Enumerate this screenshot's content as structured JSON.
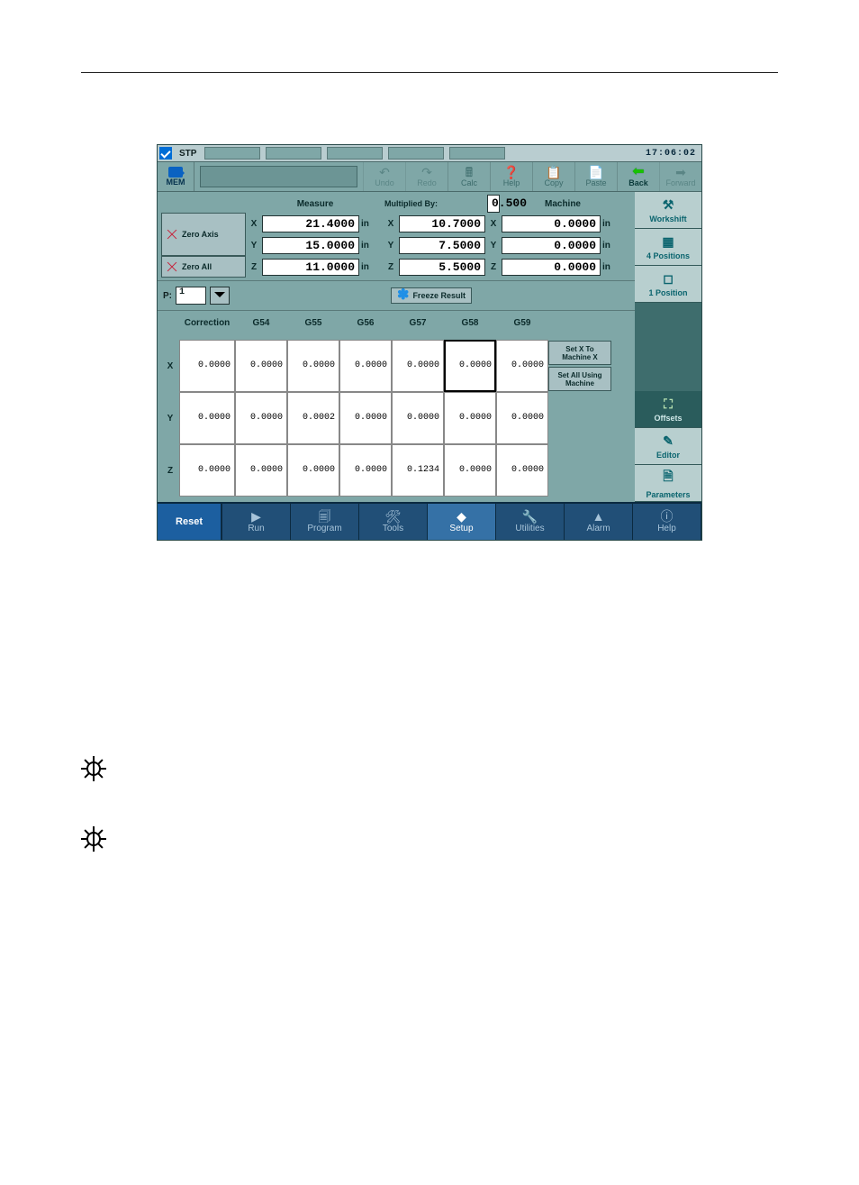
{
  "status": {
    "mode": "STP",
    "clock": "17:06:02"
  },
  "memLabel": "MEM",
  "toolbar": {
    "undo": "Undo",
    "redo": "Redo",
    "calc": "Calc",
    "help": "Help",
    "copy": "Copy",
    "paste": "Paste",
    "back": "Back",
    "forward": "Forward"
  },
  "rail": {
    "workshift": "Workshift",
    "fourPos": "4 Positions",
    "onePos": "1 Position",
    "offsets": "Offsets",
    "editor": "Editor",
    "parameters": "Parameters"
  },
  "readouts": {
    "measureHdr": "Measure",
    "multipliedHdr": "Multiplied By:",
    "machineHdr": "Machine",
    "zeroAxis": "Zero Axis",
    "zeroAll": "Zero All",
    "multiplier": "0.500",
    "rows": [
      {
        "ax": "X",
        "measure": "21.4000",
        "mUnit": "in",
        "mult": "10.7000",
        "mach": "0.0000",
        "machUnit": "in"
      },
      {
        "ax": "Y",
        "measure": "15.0000",
        "mUnit": "in",
        "mult": "7.5000",
        "mach": "0.0000",
        "machUnit": "in"
      },
      {
        "ax": "Z",
        "measure": "11.0000",
        "mUnit": "in",
        "mult": "5.5000",
        "mach": "0.0000",
        "machUnit": "in"
      }
    ]
  },
  "pRow": {
    "label": "P:",
    "value": "1",
    "freeze": "Freeze Result"
  },
  "offsets": {
    "headers": [
      "Correction",
      "G54",
      "G55",
      "G56",
      "G57",
      "G58",
      "G59"
    ],
    "setXBtn": "Set X To Machine X",
    "setAllBtn": "Set All Using Machine",
    "rows": [
      {
        "ax": "X",
        "cells": [
          "0.0000",
          "0.0000",
          "0.0000",
          "0.0000",
          "0.0000",
          "0.0000",
          "0.0000"
        ],
        "sel": 5
      },
      {
        "ax": "Y",
        "cells": [
          "0.0000",
          "0.0000",
          "0.0002",
          "0.0000",
          "0.0000",
          "0.0000",
          "0.0000"
        ],
        "sel": -1
      },
      {
        "ax": "Z",
        "cells": [
          "0.0000",
          "0.0000",
          "0.0000",
          "0.0000",
          "0.1234",
          "0.0000",
          "0.0000"
        ],
        "sel": -1
      }
    ]
  },
  "bottom": {
    "reset": "Reset",
    "items": [
      {
        "label": "Run"
      },
      {
        "label": "Program"
      },
      {
        "label": "Tools"
      },
      {
        "label": "Setup"
      },
      {
        "label": "Utilities"
      },
      {
        "label": "Alarm"
      },
      {
        "label": "Help"
      }
    ],
    "selected": 3
  }
}
